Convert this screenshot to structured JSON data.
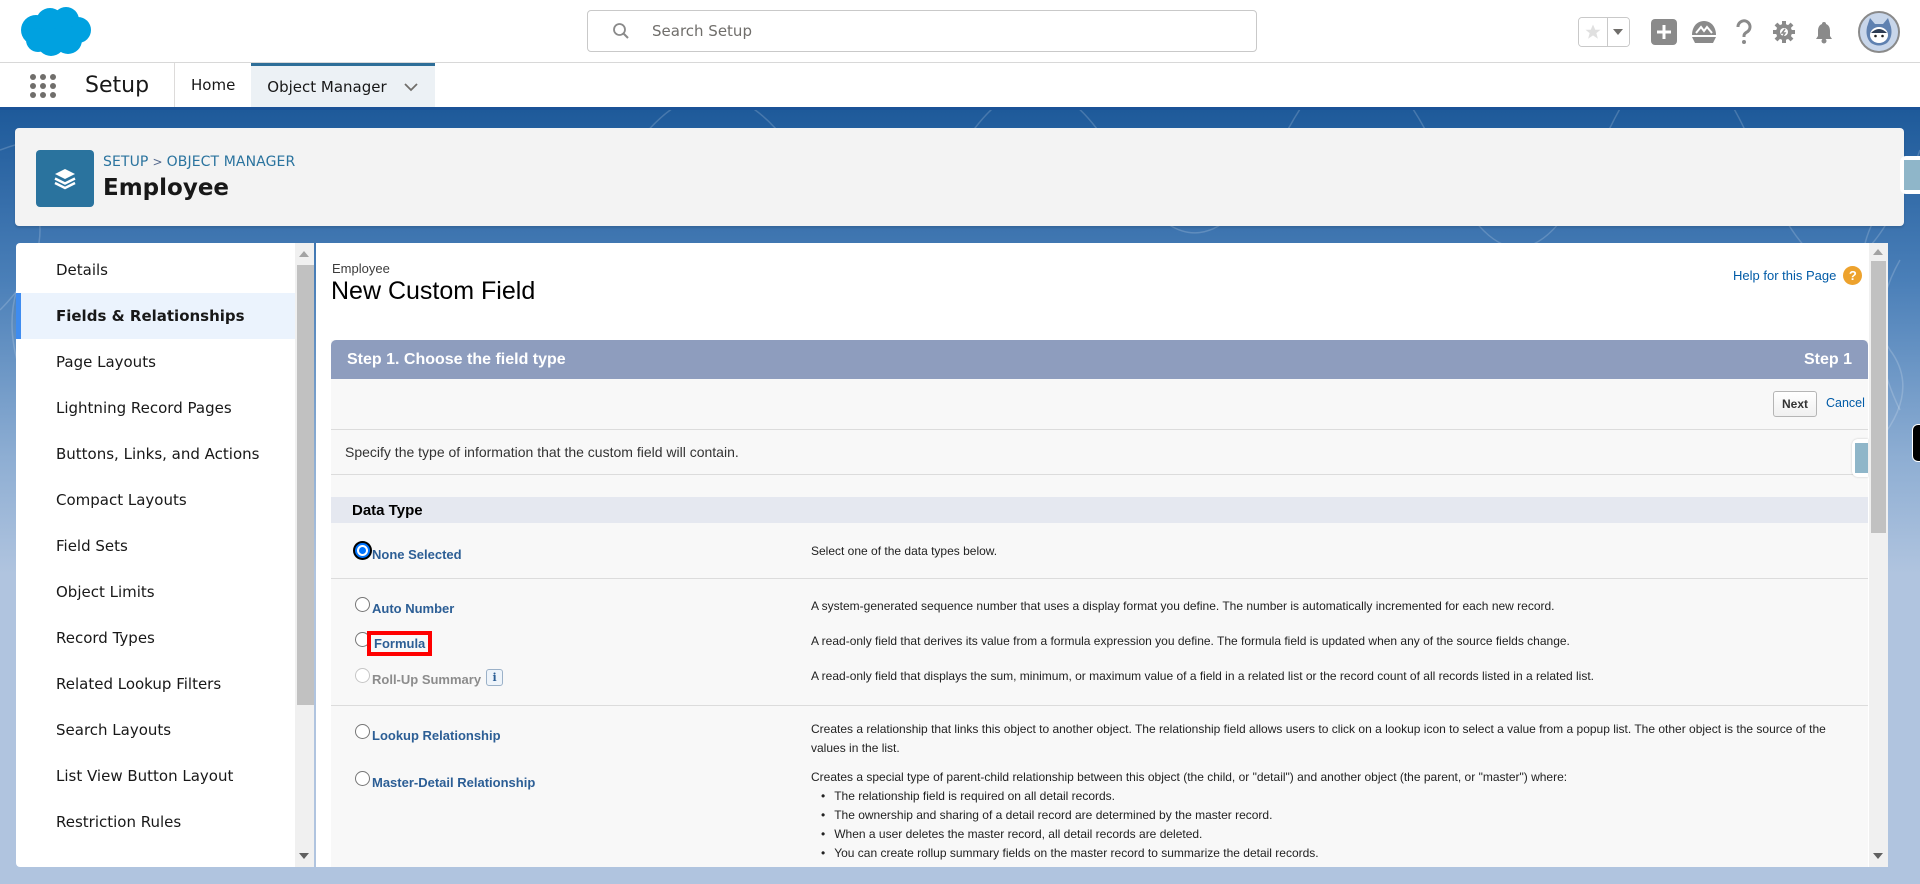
{
  "global_header": {
    "search_placeholder": "Search Setup",
    "icons": [
      "salesforce-cloud-logo",
      "search-icon",
      "favorites-star-icon",
      "favorites-dropdown-icon",
      "global-actions-plus-icon",
      "trailhead-icon",
      "help-question-icon",
      "setup-gear-icon",
      "notifications-bell-icon",
      "user-avatar"
    ]
  },
  "context_nav": {
    "app_name": "Setup",
    "tabs": [
      {
        "label": "Home",
        "active": false
      },
      {
        "label": "Object Manager",
        "active": true,
        "has_dropdown": true
      }
    ]
  },
  "page_header": {
    "breadcrumb": [
      "SETUP",
      "OBJECT MANAGER"
    ],
    "breadcrumb_separator": ">",
    "title": "Employee"
  },
  "sidebar": {
    "items": [
      {
        "label": "Details",
        "active": false
      },
      {
        "label": "Fields & Relationships",
        "active": true
      },
      {
        "label": "Page Layouts",
        "active": false
      },
      {
        "label": "Lightning Record Pages",
        "active": false
      },
      {
        "label": "Buttons, Links, and Actions",
        "active": false
      },
      {
        "label": "Compact Layouts",
        "active": false
      },
      {
        "label": "Field Sets",
        "active": false
      },
      {
        "label": "Object Limits",
        "active": false
      },
      {
        "label": "Record Types",
        "active": false
      },
      {
        "label": "Related Lookup Filters",
        "active": false
      },
      {
        "label": "Search Layouts",
        "active": false
      },
      {
        "label": "List View Button Layout",
        "active": false
      },
      {
        "label": "Restriction Rules",
        "active": false
      }
    ]
  },
  "main": {
    "object_type": "Employee",
    "page_title": "New Custom Field",
    "help_link": "Help for this Page",
    "step_title": "Step 1. Choose the field type",
    "step_indicator": "Step 1",
    "next_button": "Next",
    "cancel_link": "Cancel",
    "instructions": "Specify the type of information that the custom field will contain.",
    "data_type_header": "Data Type",
    "options": [
      {
        "label": "None Selected",
        "checked": true,
        "disabled": false,
        "description": "Select one of the data types below."
      },
      {
        "label": "Auto Number",
        "checked": false,
        "disabled": false,
        "description": "A system-generated sequence number that uses a display format you define. The number is automatically incremented for each new record."
      },
      {
        "label": "Formula",
        "checked": false,
        "disabled": false,
        "highlighted": true,
        "description": "A read-only field that derives its value from a formula expression you define. The formula field is updated when any of the source fields change."
      },
      {
        "label": "Roll-Up Summary",
        "checked": false,
        "disabled": true,
        "info": "i",
        "description": "A read-only field that displays the sum, minimum, or maximum value of a field in a related list or the record count of all records listed in a related list."
      },
      {
        "label": "Lookup Relationship",
        "checked": false,
        "disabled": false,
        "description": "Creates a relationship that links this object to another object. The relationship field allows users to click on a lookup icon to select a value from a popup list. The other object is the source of the values in the list."
      },
      {
        "label": "Master-Detail Relationship",
        "checked": false,
        "disabled": false,
        "description": "Creates a special type of parent-child relationship between this object (the child, or \"detail\") and another object (the parent, or \"master\") where:",
        "bullets": [
          "The relationship field is required on all detail records.",
          "The ownership and sharing of a detail record are determined by the master record.",
          "When a user deletes the master record, all detail records are deleted.",
          "You can create rollup summary fields on the master record to summarize the detail records."
        ]
      }
    ]
  },
  "colors": {
    "brand_blue": "#00a1e0",
    "link_blue": "#2a739e",
    "step_header": "#8e9dbe",
    "active_indicator": "#3f8cf0",
    "highlight_red": "#ff0000",
    "help_orange": "#eda22d"
  }
}
